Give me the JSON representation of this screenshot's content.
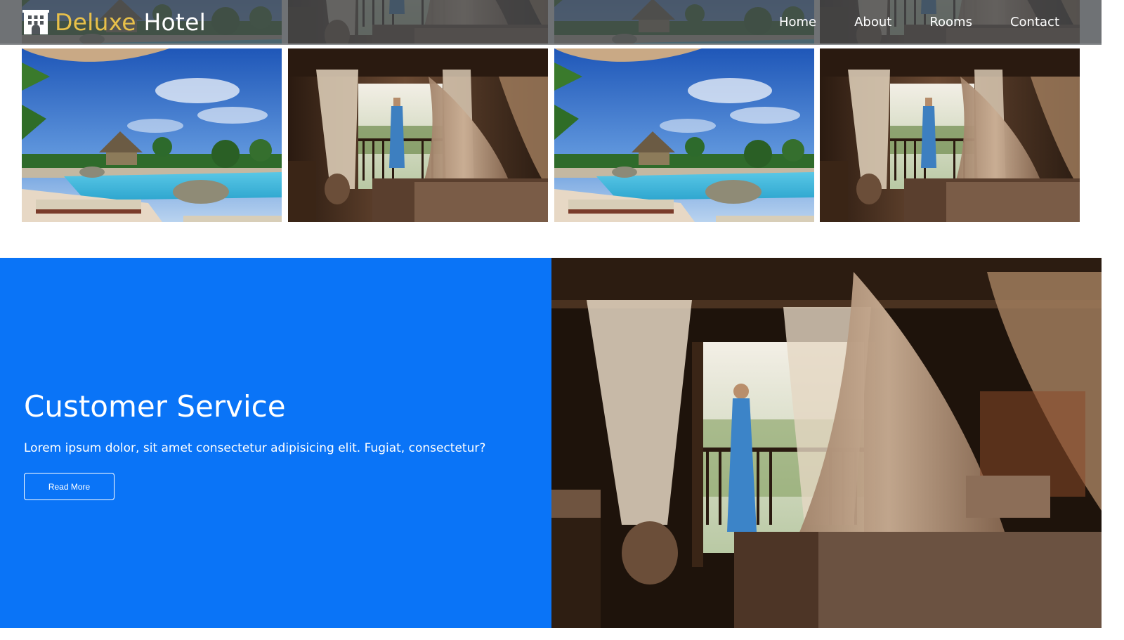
{
  "brand": {
    "icon": "hotel-building-icon",
    "name_highlight": "Deluxe",
    "name_rest": "Hotel",
    "highlight_color": "#e8c04a"
  },
  "nav": {
    "items": [
      {
        "label": "Home"
      },
      {
        "label": "About"
      },
      {
        "label": "Rooms"
      },
      {
        "label": "Contact"
      }
    ]
  },
  "gallery": {
    "images": [
      {
        "subject": "resort-pool-photo"
      },
      {
        "subject": "canopy-bedroom-photo"
      },
      {
        "subject": "resort-pool-photo"
      },
      {
        "subject": "canopy-bedroom-photo"
      }
    ]
  },
  "cta": {
    "title": "Customer Service",
    "text": "Lorem ipsum dolor, sit amet consectetur adipisicing elit. Fugiat, consectetur?",
    "button_label": "Read More",
    "background_color": "#0a74f7"
  },
  "hero": {
    "subject": "canopy-bedroom-photo"
  }
}
